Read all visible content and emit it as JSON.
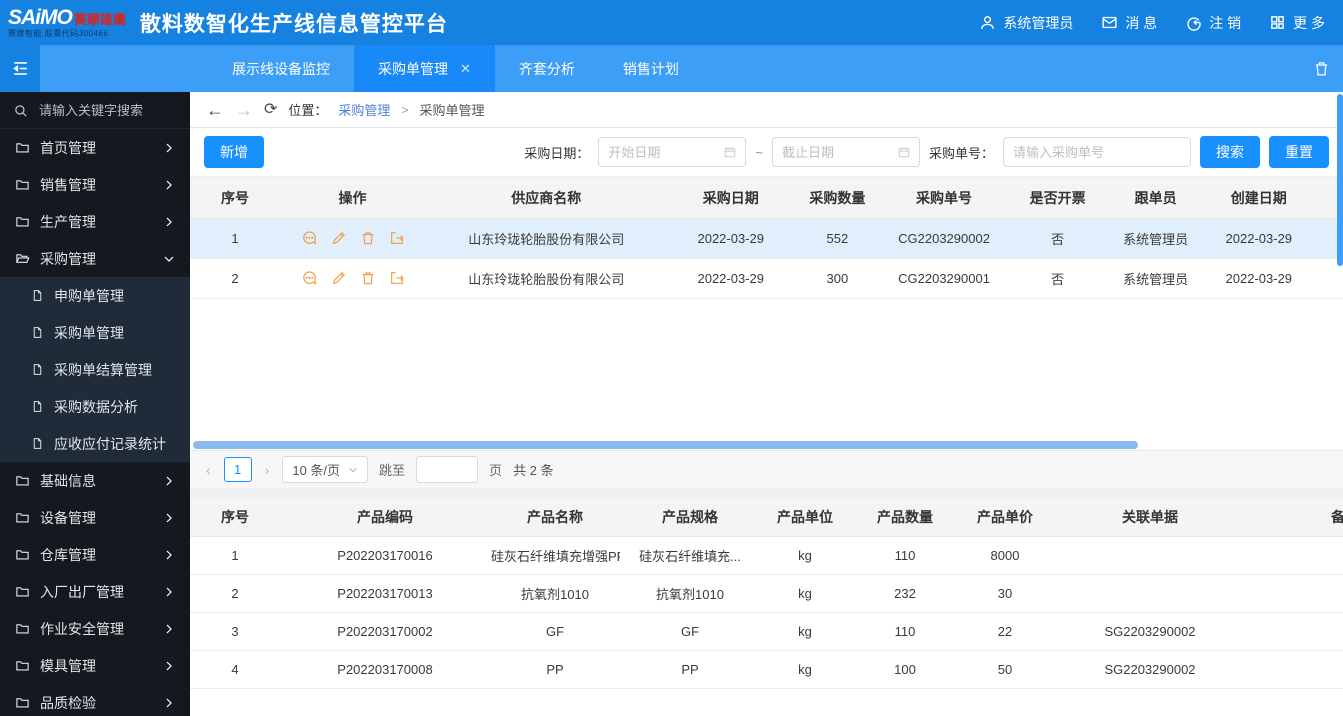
{
  "header": {
    "logo_main": "SAiMO",
    "logo_sub": "赛摩雄鹰",
    "logo_tagline": "赛摩智能 股票代码300466",
    "app_title": "散料数智化生产线信息管控平台",
    "user_label": "系统管理员",
    "messages_label": "消 息",
    "logout_label": "注 销",
    "more_label": "更 多"
  },
  "tabs": {
    "close_glyph": "✕",
    "items": [
      {
        "label": "展示线设备监控"
      },
      {
        "label": "采购单管理"
      },
      {
        "label": "齐套分析"
      },
      {
        "label": "销售计划"
      }
    ]
  },
  "sidebar": {
    "search_placeholder": "请输入关键字搜索",
    "menus": [
      {
        "label": "首页管理"
      },
      {
        "label": "销售管理"
      },
      {
        "label": "生产管理"
      },
      {
        "label": "采购管理"
      },
      {
        "label": "基础信息"
      },
      {
        "label": "设备管理"
      },
      {
        "label": "仓库管理"
      },
      {
        "label": "入厂出厂管理"
      },
      {
        "label": "作业安全管理"
      },
      {
        "label": "模具管理"
      },
      {
        "label": "品质检验"
      }
    ],
    "submenu": [
      {
        "label": "申购单管理"
      },
      {
        "label": "采购单管理"
      },
      {
        "label": "采购单结算管理"
      },
      {
        "label": "采购数据分析"
      },
      {
        "label": "应收应付记录统计"
      }
    ]
  },
  "breadcrumb": {
    "back_glyph": "←",
    "forward_glyph": "→",
    "refresh_glyph": "⟳",
    "location_label": "位置：",
    "parent": "采购管理",
    "separator": ">",
    "current": "采购单管理"
  },
  "toolbar": {
    "add_label": "新增",
    "date_label": "采购日期：",
    "date_start_placeholder": "开始日期",
    "tilde": "~",
    "date_end_placeholder": "截止日期",
    "order_label": "采购单号：",
    "order_placeholder": "请输入采购单号",
    "search_label": "搜索",
    "reset_label": "重置"
  },
  "orders_table": {
    "headers": [
      "序号",
      "操作",
      "供应商名称",
      "采购日期",
      "采购数量",
      "采购单号",
      "是否开票",
      "跟单员",
      "创建日期"
    ],
    "rows": [
      {
        "no": "1",
        "supplier": "山东玲珑轮胎股份有限公司",
        "date": "2022-03-29",
        "qty": "552",
        "order_no": "CG2203290002",
        "invoiced": "否",
        "merchandiser": "系统管理员",
        "created": "2022-03-29"
      },
      {
        "no": "2",
        "supplier": "山东玲珑轮胎股份有限公司",
        "date": "2022-03-29",
        "qty": "300",
        "order_no": "CG2203290001",
        "invoiced": "否",
        "merchandiser": "系统管理员",
        "created": "2022-03-29"
      }
    ]
  },
  "pagination": {
    "prev_glyph": "‹",
    "next_glyph": "›",
    "page": "1",
    "page_size": "10 条/页",
    "jump_label": "跳至",
    "page_suffix": "页",
    "total": "共 2 条"
  },
  "products_table": {
    "headers": [
      "序号",
      "产品编码",
      "产品名称",
      "产品规格",
      "产品单位",
      "产品数量",
      "产品单价",
      "关联单据",
      "备注"
    ],
    "rows": [
      {
        "no": "1",
        "code": "P202203170016",
        "name": "硅灰石纤维填充增强PP",
        "spec": "硅灰石纤维填充...",
        "unit": "kg",
        "qty": "110",
        "price": "8000",
        "related": "",
        "remark": ""
      },
      {
        "no": "2",
        "code": "P202203170013",
        "name": "抗氧剂1010",
        "spec": "抗氧剂1010",
        "unit": "kg",
        "qty": "232",
        "price": "30",
        "related": "",
        "remark": ""
      },
      {
        "no": "3",
        "code": "P202203170002",
        "name": "GF",
        "spec": "GF",
        "unit": "kg",
        "qty": "110",
        "price": "22",
        "related": "SG2203290002",
        "remark": ""
      },
      {
        "no": "4",
        "code": "P202203170008",
        "name": "PP",
        "spec": "PP",
        "unit": "kg",
        "qty": "100",
        "price": "50",
        "related": "SG2203290002",
        "remark": ""
      }
    ]
  },
  "colors": {
    "header_blue": "#1581e0",
    "tabbar_blue": "#3d9ef7",
    "active_tab_blue": "#1989fa",
    "button_blue": "#1890ff",
    "action_orange": "#ef9d3f",
    "selected_row_blue": "#e1eefb",
    "link_blue": "#4e7fd8",
    "sidebar_dark": "#14181f",
    "submenu_dark": "#202b39"
  }
}
